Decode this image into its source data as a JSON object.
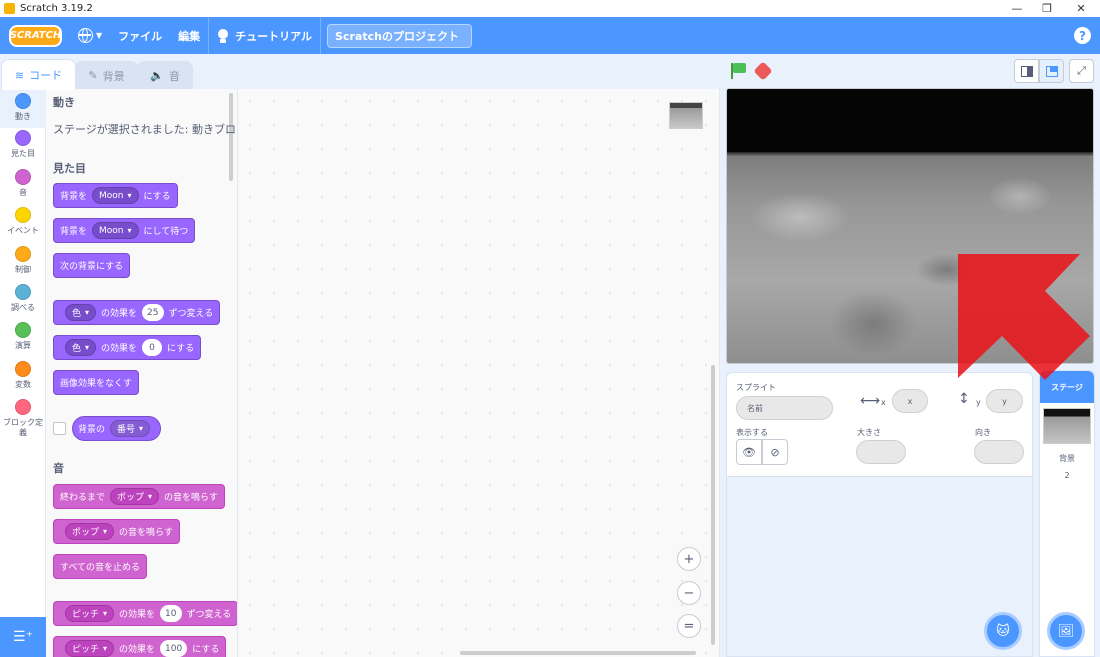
{
  "window": {
    "title": "Scratch 3.19.2",
    "controls": {
      "minimize": "—",
      "maximize": "❐",
      "close": "✕"
    }
  },
  "menubar": {
    "logo": "SCRATCH",
    "file": "ファイル",
    "edit": "編集",
    "tutorial": "チュートリアル",
    "project_title": "Scratchのプロジェクト",
    "help": "?"
  },
  "tabs": [
    {
      "label": "コード",
      "icon": "code-icon",
      "active": true
    },
    {
      "label": "背景",
      "icon": "brush-icon",
      "active": false
    },
    {
      "label": "音",
      "icon": "speaker-icon",
      "active": false
    }
  ],
  "categories": [
    {
      "label": "動き",
      "color": "#4c97ff"
    },
    {
      "label": "見た目",
      "color": "#9966ff"
    },
    {
      "label": "音",
      "color": "#cf63cf"
    },
    {
      "label": "イベント",
      "color": "#ffd500"
    },
    {
      "label": "制御",
      "color": "#ffab19"
    },
    {
      "label": "調べる",
      "color": "#5cb1d6"
    },
    {
      "label": "演算",
      "color": "#59c059"
    },
    {
      "label": "変数",
      "color": "#ff8c1a"
    },
    {
      "label": "ブロック定義",
      "color": "#ff6680"
    }
  ],
  "palette": {
    "motion_title": "動き",
    "motion_note": "ステージが選択されました: 動きブロック:",
    "looks_title": "見た目",
    "sound_title": "音",
    "blocks": {
      "switch_backdrop": {
        "pre": "背景を",
        "dd": "Moon",
        "post": "にする"
      },
      "switch_backdrop_wait": {
        "pre": "背景を",
        "dd": "Moon",
        "post": "にして待つ"
      },
      "next_backdrop": "次の背景にする",
      "change_effect": {
        "dd": "色",
        "mid": "の効果を",
        "num": "25",
        "post": "ずつ変える"
      },
      "set_effect": {
        "dd": "色",
        "mid": "の効果を",
        "num": "0",
        "post": "にする"
      },
      "clear_effects": "画像効果をなくす",
      "backdrop_reporter": {
        "pre": "背景の",
        "dd": "番号"
      },
      "play_until_done": {
        "pre": "終わるまで",
        "dd": "ポップ",
        "post": "の音を鳴らす"
      },
      "start_sound": {
        "dd": "ポップ",
        "post": "の音を鳴らす"
      },
      "stop_all_sounds": "すべての音を止める",
      "change_pitch": {
        "dd": "ピッチ",
        "mid": "の効果を",
        "num": "10",
        "post": "ずつ変える"
      },
      "set_pitch": {
        "dd": "ピッチ",
        "mid": "の効果を",
        "num": "100",
        "post": "にする"
      }
    }
  },
  "zoom": {
    "in": "+",
    "out": "−",
    "reset": "="
  },
  "sprite_info": {
    "sprite_label": "スプライト",
    "name_placeholder": "名前",
    "x_label": "x",
    "x_placeholder": "x",
    "y_label": "y",
    "y_placeholder": "y",
    "show_label": "表示する",
    "size_label": "大きさ",
    "direction_label": "向き"
  },
  "stage_selector": {
    "header": "ステージ",
    "backdrops_label": "背景",
    "backdrops_count": "2"
  }
}
